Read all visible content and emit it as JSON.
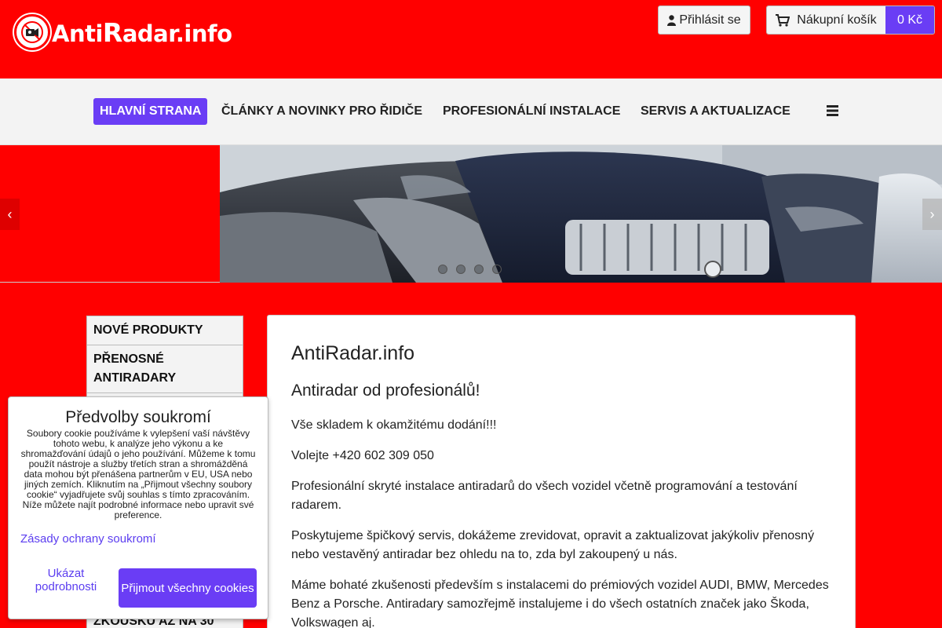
{
  "header": {
    "logo_prefix": "Anti",
    "logo_r": "R",
    "logo_suffix": "adar.info",
    "login_label": "Přihlásit se",
    "cart_label": "Nákupní košík",
    "cart_total": "0 Kč"
  },
  "nav": {
    "items": [
      {
        "label": "HLAVNÍ STRANA",
        "active": true
      },
      {
        "label": "ČLÁNKY A NOVINKY PRO ŘIDIČE"
      },
      {
        "label": "PROFESIONÁLNÍ INSTALACE"
      },
      {
        "label": "SERVIS A AKTUALIZACE"
      }
    ],
    "menu_icon": "hamburger-icon"
  },
  "slider": {
    "prev_icon": "chevron-left-icon",
    "next_icon": "chevron-right-icon",
    "prev_glyph": "‹",
    "next_glyph": "›",
    "dot_count": 4
  },
  "sidebar": {
    "items": [
      {
        "label": "NOVÉ PRODUKTY"
      },
      {
        "label": "PŘENOSNÉ ANTIRADARY"
      },
      {
        "label": "ZKOUŠKU AŽ NA 30"
      }
    ]
  },
  "main": {
    "title": "AntiRadar.info",
    "subtitle": "Antiradar od profesionálů!",
    "paragraphs": [
      "Vše skladem k okamžitému dodání!!!",
      "Volejte +420 602 309 050",
      "Profesionální skryté instalace antiradarů do všech vozidel včetně programování a testování radarem.",
      "Poskytujeme špičkový servis, dokážeme zrevidovat, opravit a zaktualizovat jakýkoliv přenosný nebo vestavěný antiradar bez ohledu na to, zda byl zakoupený u nás.",
      "Máme bohaté zkušenosti především s instalacemi do prémiových vozidel AUDI, BMW, Mercedes Benz a Porsche. Antiradary samozřejmě instalujeme i do všech ostatních značek jako Škoda, Volkswagen aj."
    ]
  },
  "cookie": {
    "title": "Předvolby soukromí",
    "text": "Soubory cookie používáme k vylepšení vaší návštěvy tohoto webu, k analýze jeho výkonu a ke shromažďování údajů o jeho používání. Můžeme k tomu použít nástroje a služby třetích stran a shromážděná data mohou být přenášena partnerům v EU, USA nebo jiných zemích. Kliknutím na „Přijmout všechny soubory cookie“ vyjadřujete svůj souhlas s tímto zpracováním. Níže můžete najít podrobné informace nebo upravit své preference.",
    "privacy_link": "Zásady ochrany soukromí",
    "details_button": "Ukázat podrobnosti",
    "accept_button": "Přijmout všechny cookies"
  },
  "colors": {
    "brand_red": "#ff0000",
    "accent_purple": "#6a3df5"
  }
}
